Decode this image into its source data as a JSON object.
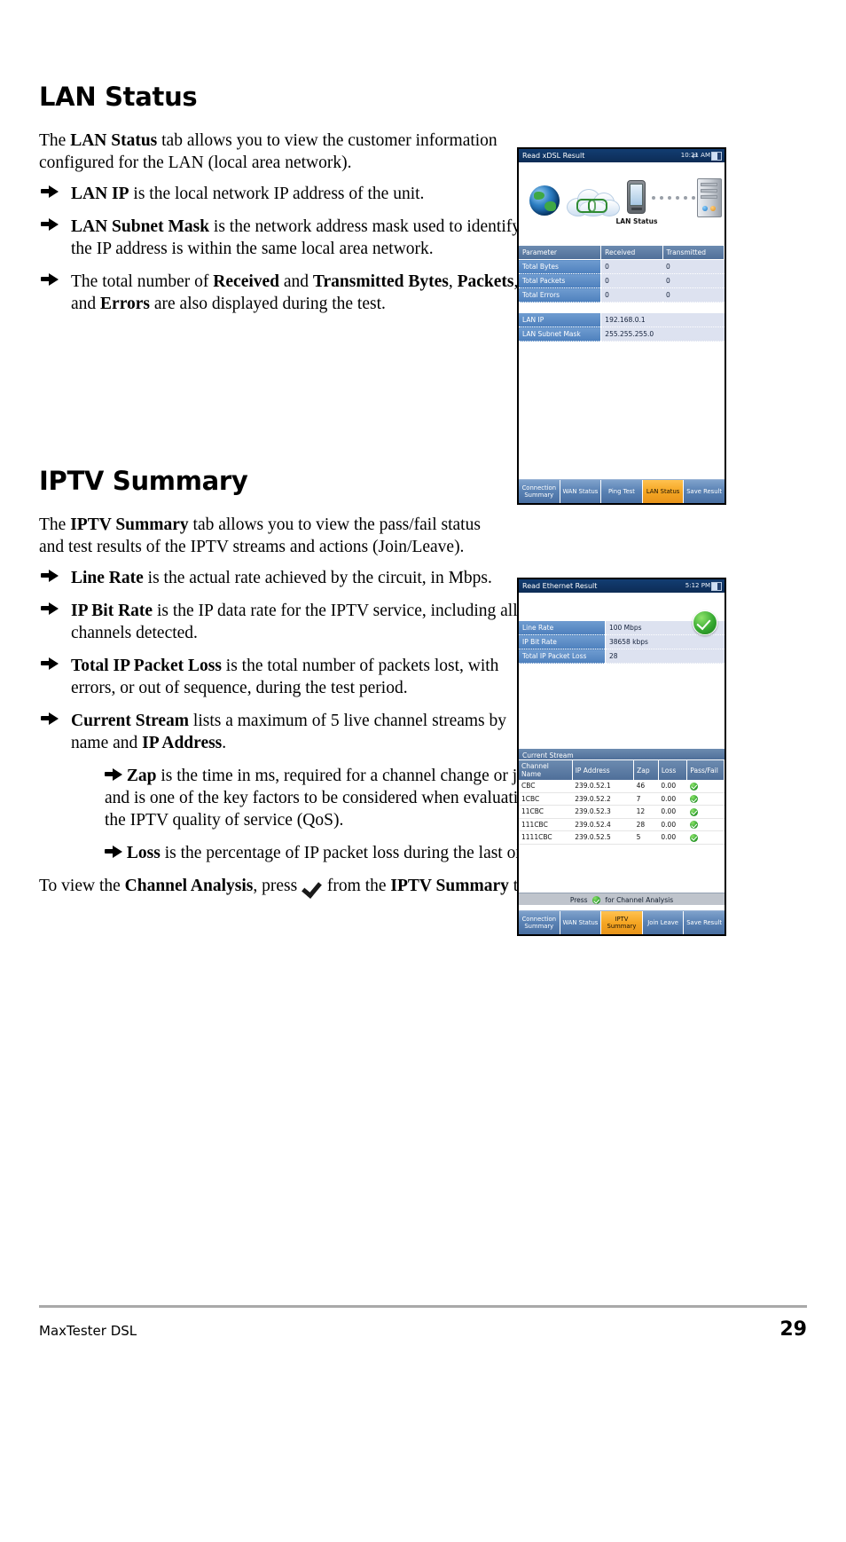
{
  "document": {
    "footer_name": "MaxTester DSL",
    "page_number": "29"
  },
  "sections": [
    {
      "title": "LAN Status",
      "intro_parts": [
        "The ",
        "LAN Status",
        " tab allows you to view the customer information configured for the LAN (local area network)."
      ],
      "bullets": [
        {
          "lead": "LAN IP",
          "rest": " is the local network IP address of the unit."
        },
        {
          "lead": "LAN Subnet Mask",
          "rest": " is the network address mask used to identify if the IP address is within the same local area network."
        }
      ]
    },
    {
      "title": "IPTV Summary"
    }
  ],
  "lan_section": {
    "title": "LAN Status",
    "intro_a": "The ",
    "intro_b": "LAN Status",
    "intro_c": " tab allows you to view the customer information configured for the LAN (local area network).",
    "b1_lead": "LAN IP",
    "b1_rest": " is the local network IP address of the unit.",
    "b2_lead": "LAN Subnet Mask",
    "b2_rest": " is the network address mask used to identify if the IP address is within the same local area network.",
    "b3_p1": "The total number of ",
    "b3_b1": "Received",
    "b3_p2": " and ",
    "b3_b2": "Transmitted Bytes",
    "b3_p3": ", ",
    "b3_b3": "Packets",
    "b3_p4": ", and ",
    "b3_b4": "Errors",
    "b3_p5": " are also displayed during the test."
  },
  "iptv_section": {
    "title": "IPTV Summary",
    "intro_a": "The ",
    "intro_b": "IPTV Summary",
    "intro_c": " tab allows you to view the pass/fail status and test results of the IPTV streams and actions (Join/Leave).",
    "b1_lead": "Line Rate",
    "b1_rest": " is the actual rate achieved by the circuit, in Mbps.",
    "b2_lead": "IP Bit Rate",
    "b2_rest": " is the IP data rate for the IPTV service, including all channels detected.",
    "b3_lead": "Total IP Packet Loss",
    "b3_rest": " is the total number of packets lost, with errors, or out of sequence, during the test period.",
    "b4_lead": "Current Stream",
    "b4_mid": " lists a maximum of 5 live channel streams by name and ",
    "b4_bold2": "IP Address",
    "b4_end": ".",
    "sub1_lead": "Zap",
    "sub1_rest": " is the time in ms, required for a channel change or join, and is one of the key factors to be considered when evaluating the IPTV quality of service (QoS).",
    "sub2_lead": "Loss",
    "sub2_rest": " is the percentage of IP packet loss during the last one-second period.",
    "closing_a": "To view the ",
    "closing_b": "Channel Analysis",
    "closing_c": ", press ",
    "closing_d": " from the ",
    "closing_e": "IPTV Summary",
    "closing_f": " tab."
  },
  "device_lan": {
    "title": "Read xDSL Result",
    "clock": "10:21 AM",
    "topology_label": "LAN Status",
    "stats_table": {
      "headers": [
        "Parameter",
        "Received",
        "Transmitted"
      ],
      "rows": [
        {
          "label": "Total Bytes",
          "received": "0",
          "transmitted": "0"
        },
        {
          "label": "Total Packets",
          "received": "0",
          "transmitted": "0"
        },
        {
          "label": "Total Errors",
          "received": "0",
          "transmitted": "0"
        }
      ]
    },
    "info_table": {
      "rows": [
        {
          "label": "LAN IP",
          "value": "192.168.0.1"
        },
        {
          "label": "LAN Subnet Mask",
          "value": "255.255.255.0"
        }
      ]
    },
    "tabs": [
      {
        "label": "Connection Summary",
        "active": false
      },
      {
        "label": "WAN Status",
        "active": false
      },
      {
        "label": "Ping Test",
        "active": false
      },
      {
        "label": "LAN Status",
        "active": true
      },
      {
        "label": "Save Result",
        "active": false
      }
    ]
  },
  "device_iptv": {
    "title": "Read Ethernet Result",
    "clock": "5:12 PM",
    "summary_table": {
      "rows": [
        {
          "label": "Line Rate",
          "value": "100 Mbps"
        },
        {
          "label": "IP Bit Rate",
          "value": "38658 kbps"
        },
        {
          "label": "Total IP Packet Loss",
          "value": "28"
        }
      ]
    },
    "current_stream_title": "Current Stream",
    "stream_table": {
      "headers": [
        "Channel Name",
        "IP Address",
        "Zap",
        "Loss",
        "Pass/Fail"
      ],
      "rows": [
        {
          "name": "CBC",
          "ip": "239.0.52.1",
          "zap": "46",
          "loss": "0.00",
          "pass": true
        },
        {
          "name": "1CBC",
          "ip": "239.0.52.2",
          "zap": "7",
          "loss": "0.00",
          "pass": true
        },
        {
          "name": "11CBC",
          "ip": "239.0.52.3",
          "zap": "12",
          "loss": "0.00",
          "pass": true
        },
        {
          "name": "111CBC",
          "ip": "239.0.52.4",
          "zap": "28",
          "loss": "0.00",
          "pass": true
        },
        {
          "name": "1111CBC",
          "ip": "239.0.52.5",
          "zap": "5",
          "loss": "0.00",
          "pass": true
        }
      ]
    },
    "press_bar_pre": "Press",
    "press_bar_post": "for Channel Analysis",
    "tabs": [
      {
        "label": "Connection Summary",
        "active": false
      },
      {
        "label": "WAN Status",
        "active": false
      },
      {
        "label": "IPTV Summary",
        "active": true
      },
      {
        "label": "Join Leave",
        "active": false
      },
      {
        "label": "Save Result",
        "active": false
      }
    ]
  },
  "colors": {
    "title_bar": "#0d2c55",
    "table_header": "#4f6f99",
    "table_label": "#4e80bd",
    "table_value_bg": "#dde2f0",
    "tab_active": "#f5a623",
    "pass_green": "#35a830"
  }
}
